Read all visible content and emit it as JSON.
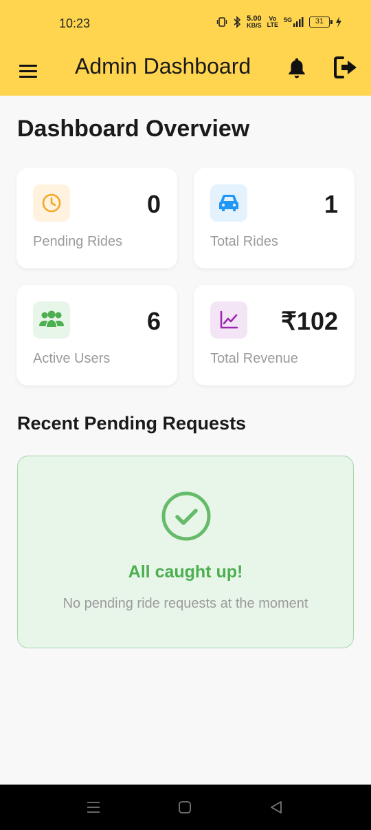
{
  "status_bar": {
    "time": "10:23",
    "speed_value": "5.00",
    "speed_unit": "KB/S",
    "volte_top": "Vo",
    "volte_bottom": "LTE",
    "network": "5G",
    "battery": "31"
  },
  "app_bar": {
    "title": "Admin Dashboard",
    "icons": [
      "menu-icon",
      "bell-icon",
      "logout-icon"
    ]
  },
  "overview": {
    "title": "Dashboard Overview",
    "cards": [
      {
        "label": "Pending Rides",
        "value": "0",
        "icon": "clock-icon",
        "color": "#f5a623",
        "bg": "#fff3e0"
      },
      {
        "label": "Total Rides",
        "value": "1",
        "icon": "car-icon",
        "color": "#2196f3",
        "bg": "#e3f2fd"
      },
      {
        "label": "Active Users",
        "value": "6",
        "icon": "users-icon",
        "color": "#4caf50",
        "bg": "#e8f5e9"
      },
      {
        "label": "Total Revenue",
        "value": "₹102",
        "icon": "trending-up-icon",
        "color": "#9c27b0",
        "bg": "#f3e5f5"
      }
    ]
  },
  "pending": {
    "title": "Recent Pending Requests",
    "empty_title": "All caught up!",
    "empty_subtitle": "No pending ride requests at the moment",
    "icon": "check-circle-icon",
    "accent": "#4caf50"
  },
  "nav_bar": {
    "icons": [
      "recents-icon",
      "home-icon",
      "back-icon"
    ]
  },
  "colors": {
    "app_bar": "#ffd54f",
    "background": "#f8f8f8"
  }
}
